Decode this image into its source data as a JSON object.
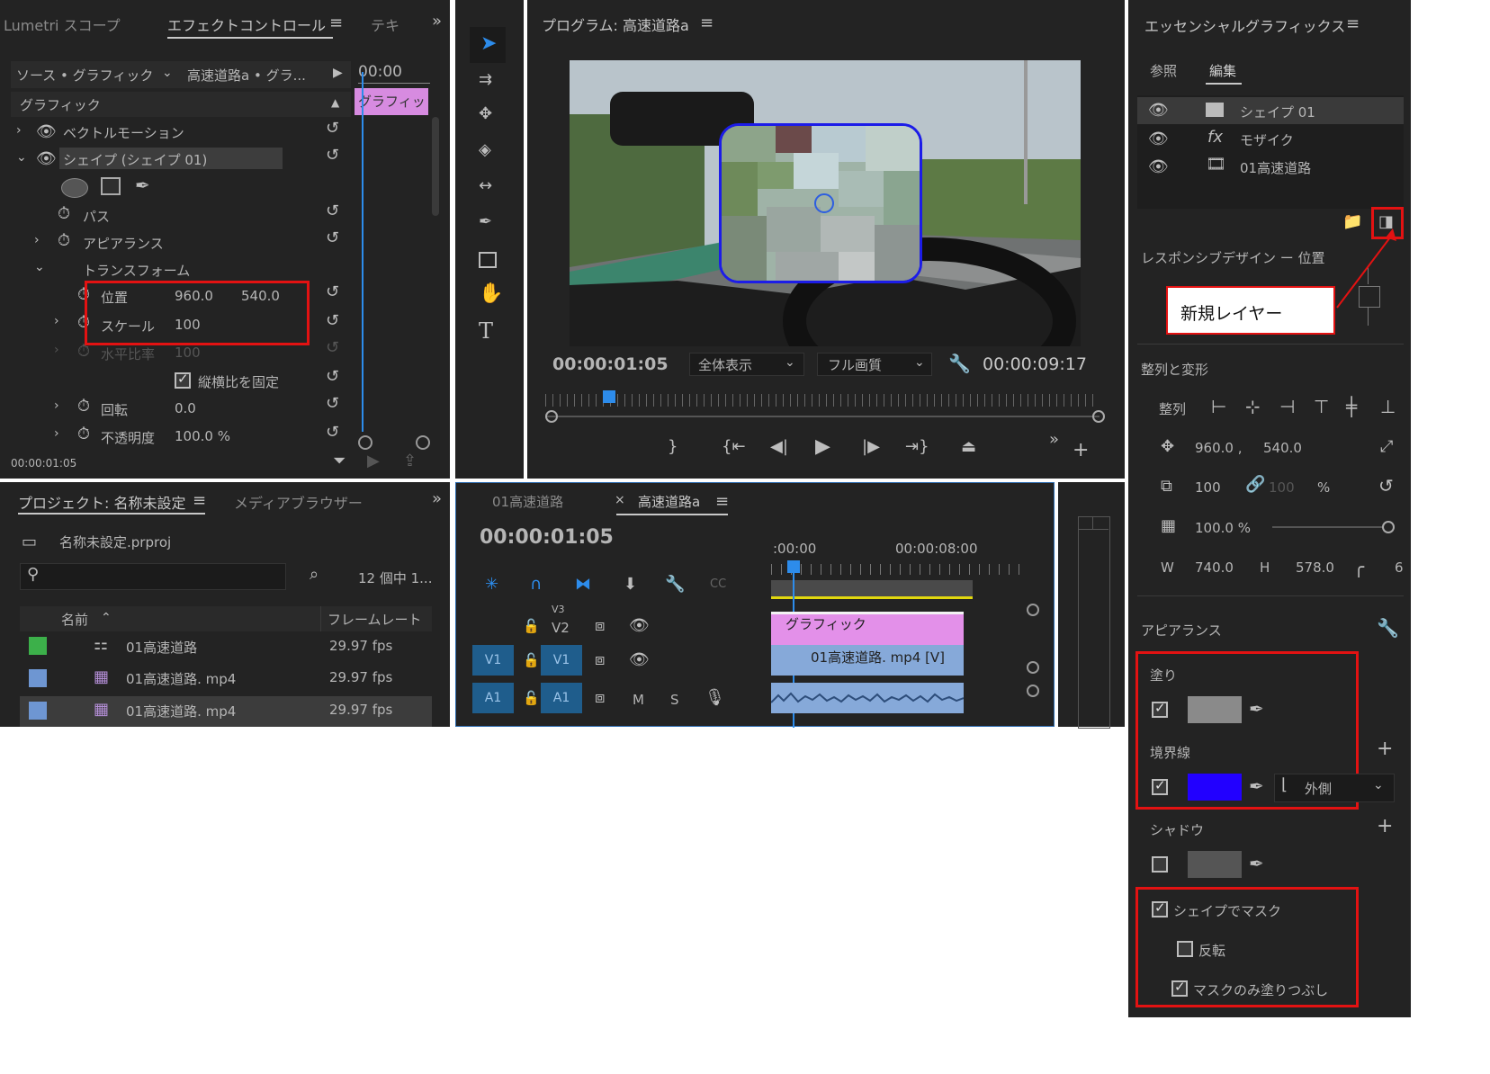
{
  "left_tabs": {
    "lumetri": "Lumetri スコープ",
    "effect": "エフェクトコントロール",
    "text": "テキ"
  },
  "effect": {
    "source": "ソース • グラフィック",
    "clip": "高速道路a • グラ...",
    "time_ruler": "00:00",
    "clip_bar": "グラフィッ",
    "graphic": "グラフィック",
    "vector_motion": "ベクトルモーション",
    "shape": "シェイプ (シェイプ 01)",
    "path": "パス",
    "appearance": "アピアランス",
    "transform": "トランスフォーム",
    "position_label": "位置",
    "position_x": "960.0",
    "position_y": "540.0",
    "scale_label": "スケール",
    "scale_val": "100",
    "hscale_label": "水平比率",
    "hscale_val": "100",
    "aspect_lock": "縦横比を固定",
    "rotation_label": "回転",
    "rotation_val": "0.0",
    "opacity_label": "不透明度",
    "opacity_val": "100.0 %",
    "timecode": "00:00:01:05"
  },
  "program": {
    "title": "プログラム: 高速道路a",
    "timecode": "00:00:01:05",
    "zoom": "全体表示",
    "quality": "フル画質",
    "duration": "00:00:09:17"
  },
  "project": {
    "tab": "プロジェクト: 名称未設定",
    "media_tab": "メディアブラウザー",
    "file": "名称未設定.prproj",
    "count": "12 個中 1...",
    "col_name": "名前",
    "col_fps": "フレームレート",
    "items": [
      {
        "name": "01高速道路",
        "fps": "29.97 fps",
        "color": "#3cb04a"
      },
      {
        "name": "01高速道路. mp4",
        "fps": "29.97 fps",
        "color": "#6e96d2"
      },
      {
        "name": "01高速道路. mp4",
        "fps": "29.97 fps",
        "color": "#6e96d2"
      }
    ]
  },
  "timeline": {
    "tab1": "01高速道路",
    "tab2": "高速道路a",
    "timecode": "00:00:01:05",
    "ruler_start": ":00:00",
    "ruler_mid": "00:00:08:00",
    "v2": "V2",
    "v1": "V1",
    "a1": "A1",
    "v3": "V3",
    "clip_graphic": "グラフィック",
    "clip_video": "01高速道路. mp4 [V]",
    "m": "M",
    "s": "S"
  },
  "essential": {
    "title": "エッセンシャルグラフィックス",
    "tab_browse": "参照",
    "tab_edit": "編集",
    "layers": [
      {
        "name": "シェイプ 01",
        "icon": "shape-icon"
      },
      {
        "name": "モザイク",
        "icon": "fx-icon"
      },
      {
        "name": "01高速道路",
        "icon": "film-icon"
      }
    ],
    "responsive": "レスポンシブデザイン ー 位置",
    "callout": "新規レイヤー",
    "align_title": "整列と変形",
    "align_label": "整列",
    "pos_x": "960.0 ,",
    "pos_y": "540.0",
    "scale": "100",
    "scale2": "100",
    "percent": "%",
    "opacity": "100.0 %",
    "w_label": "W",
    "w_val": "740.0",
    "h_label": "H",
    "h_val": "578.0",
    "corner": "6",
    "appearance": "アピアランス",
    "fill": "塗り",
    "stroke": "境界線",
    "stroke_mode": "外側",
    "shadow": "シャドウ",
    "mask": "シェイプでマスク",
    "invert": "反転",
    "fill_only": "マスクのみ塗りつぶし",
    "fill_color": "#8a8a8a",
    "stroke_color": "#2200ff",
    "shadow_color": "#555555"
  },
  "colors": {
    "accent": "#2d8ceb",
    "highlight": "#e31212",
    "bg": "#232323"
  }
}
